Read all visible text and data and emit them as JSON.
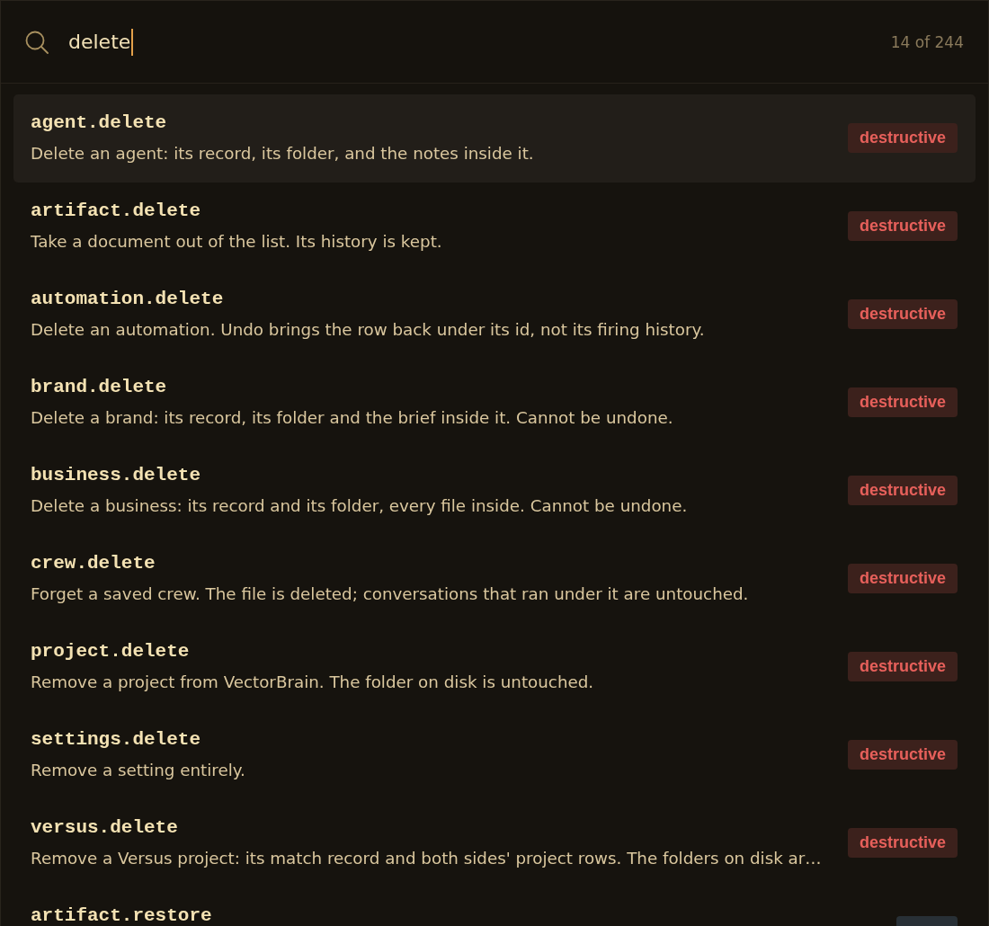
{
  "search": {
    "value": "delete",
    "focused": true,
    "count": "14 of 244"
  },
  "results": [
    {
      "name": "agent.delete",
      "description": "Delete an agent: its record, its folder, and the notes inside it.",
      "selected": true,
      "tag": {
        "label": "destructive",
        "color": "#3c211c"
      }
    },
    {
      "name": "artifact.delete",
      "description": "Take a document out of the list. Its history is kept.",
      "selected": false,
      "tag": {
        "label": "destructive",
        "color": "#3c211c"
      }
    },
    {
      "name": "automation.delete",
      "description": "Delete an automation. Undo brings the row back under its id, not its firing history.",
      "selected": false,
      "tag": {
        "label": "destructive",
        "color": "#3c211c"
      }
    },
    {
      "name": "brand.delete",
      "description": "Delete a brand: its record, its folder and the brief inside it. Cannot be undone.",
      "selected": false,
      "tag": {
        "label": "destructive",
        "color": "#3c211c"
      }
    },
    {
      "name": "business.delete",
      "description": "Delete a business: its record and its folder, every file inside. Cannot be undone.",
      "selected": false,
      "tag": {
        "label": "destructive",
        "color": "#3c211c"
      }
    },
    {
      "name": "crew.delete",
      "description": "Forget a saved crew. The file is deleted; conversations that ran under it are untouched.",
      "selected": false,
      "tag": {
        "label": "destructive",
        "color": "#3c211c"
      }
    },
    {
      "name": "project.delete",
      "description": "Remove a project from VectorBrain. The folder on disk is untouched.",
      "selected": false,
      "tag": {
        "label": "destructive",
        "color": "#3c211c"
      }
    },
    {
      "name": "settings.delete",
      "description": "Remove a setting entirely.",
      "selected": false,
      "tag": {
        "label": "destructive",
        "color": "#3c211c"
      }
    },
    {
      "name": "versus.delete",
      "description": "Remove a Versus project: its match record and both sides' project rows. The folders on disk ar…",
      "selected": false,
      "tag": {
        "label": "destructive",
        "color": "#3c211c"
      }
    },
    {
      "name": "artifact.restore",
      "selected": false,
      "tag": {
        "color": "#283036"
      }
    }
  ]
}
